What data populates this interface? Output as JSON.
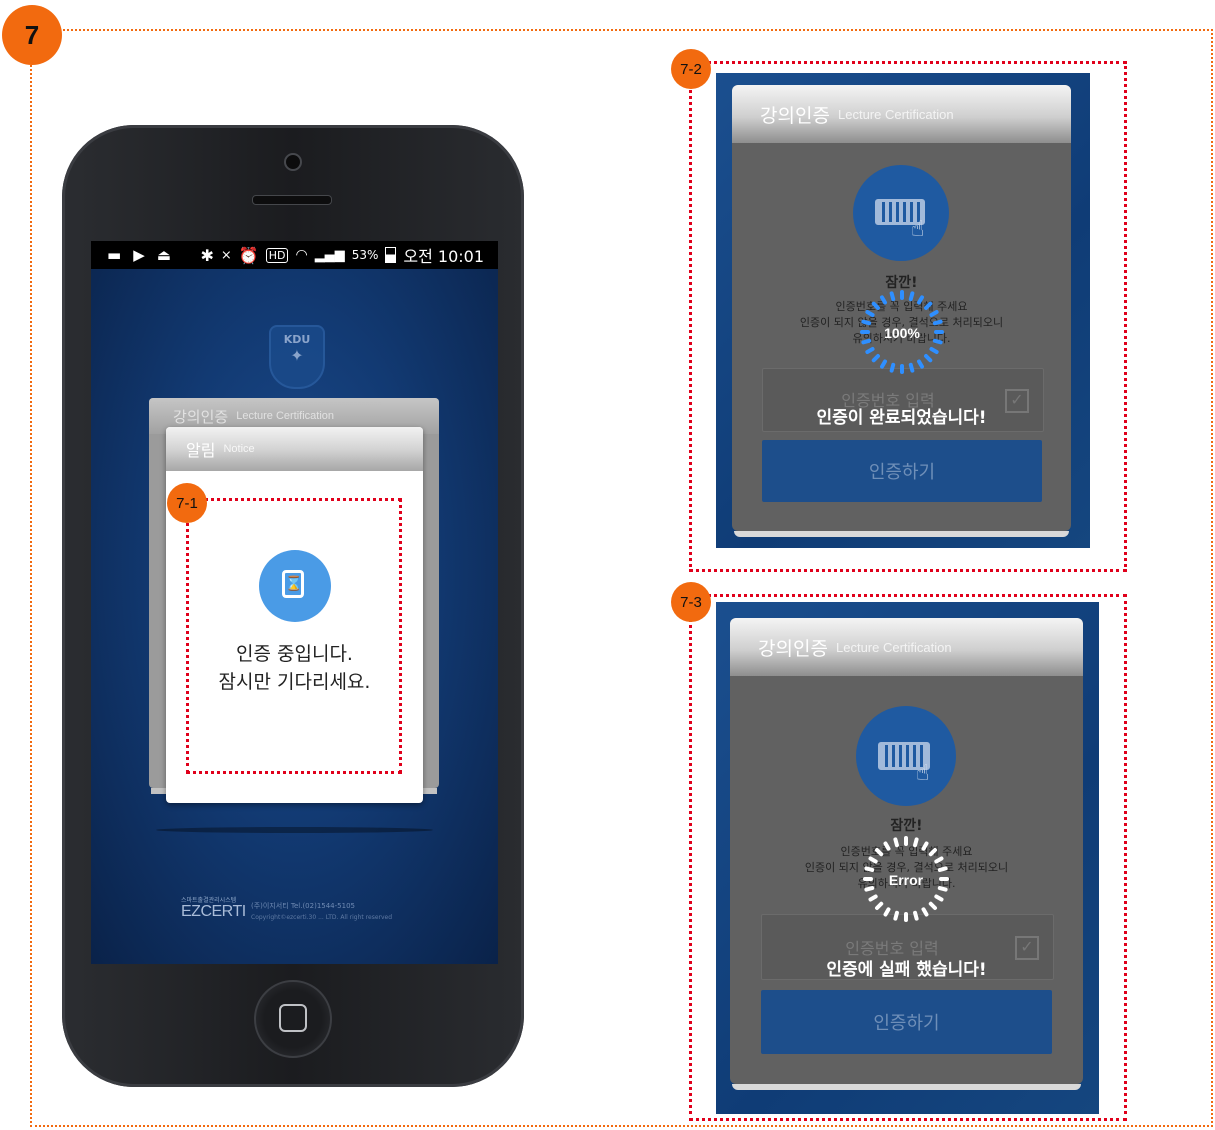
{
  "badges": {
    "main": "7",
    "b71": "7-1",
    "b72": "7-2",
    "b73": "7-3"
  },
  "status_bar": {
    "battery": "53%",
    "time": "오전 10:01",
    "hd": "HD"
  },
  "logo": {
    "crest": "KDU"
  },
  "card_back": {
    "title": "강의인증",
    "subtitle": "Lecture Certification"
  },
  "notice": {
    "title": "알림",
    "subtitle": "Notice",
    "line1": "인증 중입니다.",
    "line2": "잠시만 기다리세요."
  },
  "footer": {
    "brand": "EZCERTI",
    "contact": "(주)이지서티  Tel.(02)1544-5105",
    "copyright": "Copyright©ezcerti.30 ... LTD. All right reserved",
    "tagline": "스마트출결관리시스템"
  },
  "panel2": {
    "title": "강의인증",
    "subtitle": "Lecture Certification",
    "wait": "잠깐!",
    "desc1": "인증번호를 꼭 입력해 주세요",
    "desc2": "인증이 되지 않을 경우, 결석으로 처리되오니",
    "desc3": "유의하시기 바랍니다.",
    "spinner": "100%",
    "input_placeholder": "인증번호 입력",
    "message": "인증이 완료되었습니다!",
    "button": "인증하기"
  },
  "panel3": {
    "title": "강의인증",
    "subtitle": "Lecture Certification",
    "wait": "잠깐!",
    "desc1": "인증번호를 꼭 입력해 주세요",
    "desc2": "인증이 되지 않을 경우, 결석으로 처리되오니",
    "desc3": "유의하시기 바랍니다.",
    "spinner": "Error",
    "input_placeholder": "인증번호 입력",
    "message": "인증에 실패 했습니다!",
    "button": "인증하기"
  },
  "colors": {
    "accent_orange": "#f26a0f",
    "dotted_red": "#e0001b",
    "spinner_blue": "#2f8fff",
    "spinner_white": "#ffffff",
    "panel_blue": "#124079"
  }
}
